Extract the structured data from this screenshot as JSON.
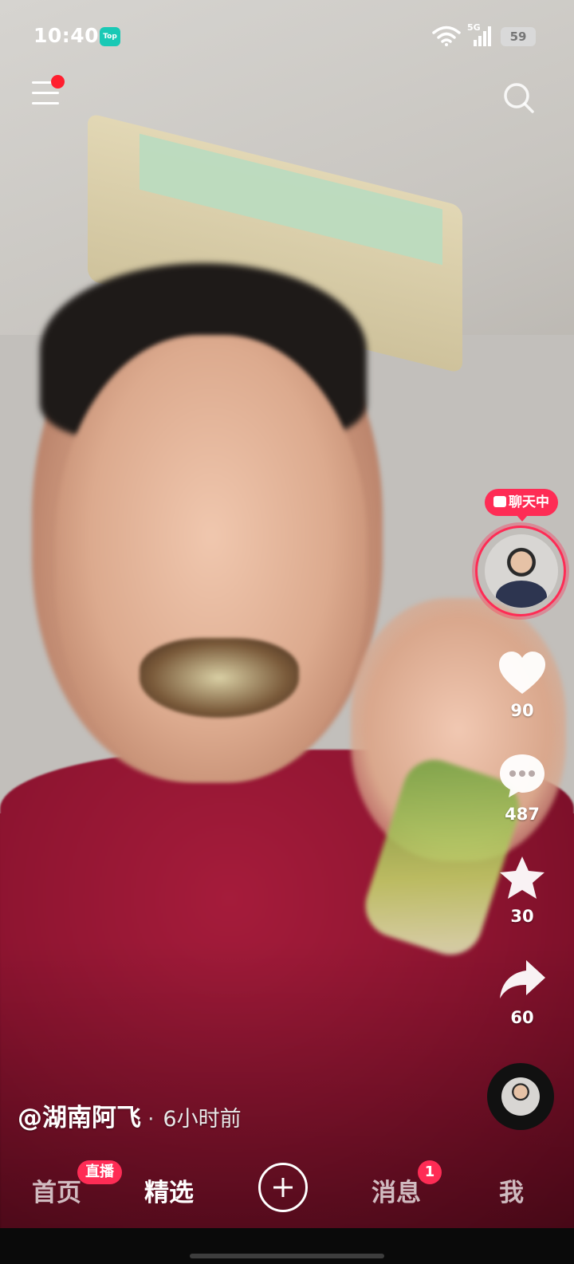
{
  "status_bar": {
    "time": "10:40",
    "app_badge": "Top",
    "network": "5G",
    "battery": "59"
  },
  "right_rail": {
    "chat_badge": "聊天中",
    "like_count": "90",
    "comment_count": "487",
    "favorite_count": "30",
    "share_count": "60"
  },
  "caption": {
    "author": "@湖南阿飞",
    "separator": "·",
    "posted": "6小时前"
  },
  "bottom_nav": {
    "home": "首页",
    "live_badge": "直播",
    "featured": "精选",
    "messages": "消息",
    "messages_badge": "1",
    "me": "我"
  },
  "colors": {
    "accent": "#fe2c55",
    "menu_dot": "#ff1e2e",
    "app_badge": "#19c9b5"
  },
  "icons": [
    "menu-icon",
    "search-icon",
    "heart-icon",
    "comment-icon",
    "star-icon",
    "share-icon",
    "plus-icon",
    "wifi-icon",
    "signal-icon"
  ]
}
